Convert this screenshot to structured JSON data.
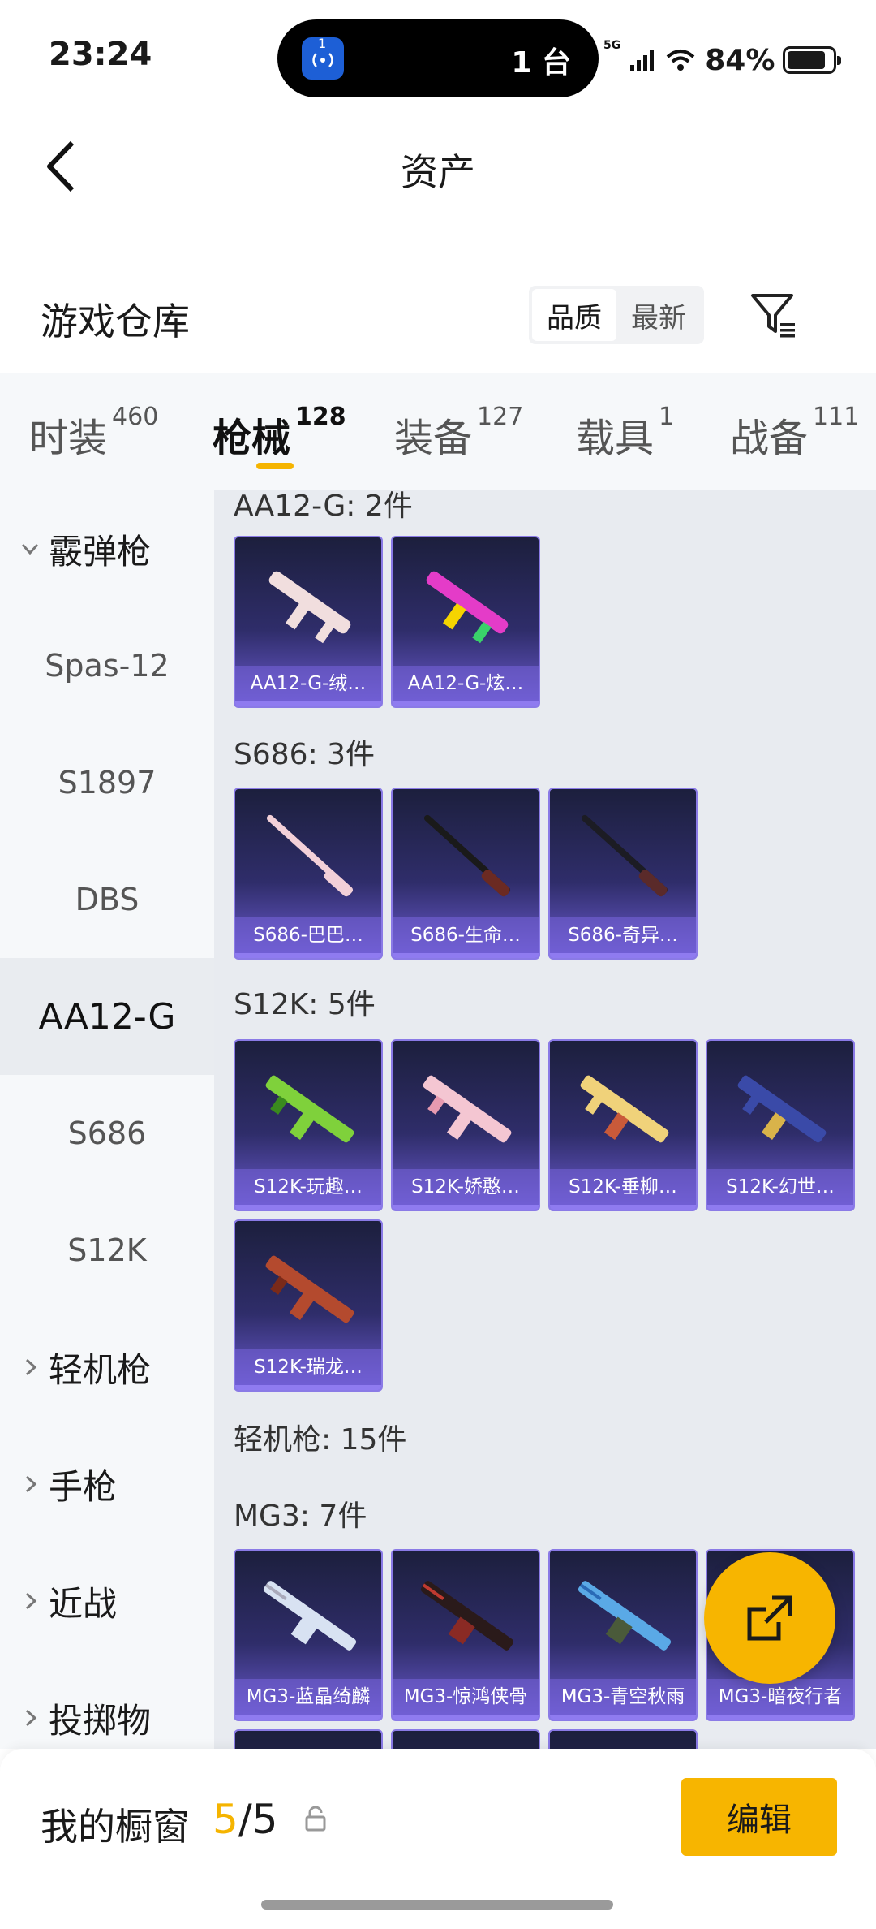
{
  "status": {
    "time": "23:24",
    "island_badge": "1",
    "island_text": "1 台",
    "network": "5G",
    "battery": "84%",
    "battery_level": 0.84
  },
  "header": {
    "title": "资产",
    "back_icon": "chevron-left-icon"
  },
  "warehouse": {
    "title": "游戏仓库",
    "sort_options": [
      "品质",
      "最新"
    ],
    "filter_icon": "filter-icon"
  },
  "tabs": [
    {
      "label": "时装",
      "count": "460"
    },
    {
      "label": "枪械",
      "count": "128",
      "active": true
    },
    {
      "label": "装备",
      "count": "127"
    },
    {
      "label": "载具",
      "count": "1"
    },
    {
      "label": "战备",
      "count": "111"
    }
  ],
  "sidebar": [
    {
      "label": "霰弹枪",
      "type": "group",
      "expanded": true
    },
    {
      "label": "Spas-12",
      "type": "sub"
    },
    {
      "label": "S1897",
      "type": "sub"
    },
    {
      "label": "DBS",
      "type": "sub"
    },
    {
      "label": "AA12-G",
      "type": "sub",
      "active": true
    },
    {
      "label": "S686",
      "type": "sub"
    },
    {
      "label": "S12K",
      "type": "sub"
    },
    {
      "label": "轻机枪",
      "type": "group"
    },
    {
      "label": "手枪",
      "type": "group"
    },
    {
      "label": "近战",
      "type": "group"
    },
    {
      "label": "投掷物",
      "type": "group"
    }
  ],
  "sections": [
    {
      "label": "AA12-G: 2件",
      "items": [
        "AA12-G-绒…",
        "AA12-G-炫…"
      ]
    },
    {
      "label": "S686: 3件",
      "items": [
        "S686-巴巴…",
        "S686-生命…",
        "S686-奇异…"
      ]
    },
    {
      "label": "S12K: 5件",
      "items": [
        "S12K-玩趣…",
        "S12K-娇憨…",
        "S12K-垂柳…",
        "S12K-幻世…",
        "S12K-瑞龙…"
      ]
    },
    {
      "label": "轻机枪: 15件",
      "items": []
    },
    {
      "label": "MG3: 7件",
      "items": [
        "MG3-蓝晶绮麟",
        "MG3-惊鸿侠骨",
        "MG3-青空秋雨",
        "MG3-暗夜行者"
      ]
    }
  ],
  "weapon_colors": {
    "aa12_1": "#f1dede",
    "aa12_2": "#e43cc8",
    "s686_1": "#f3d0d8",
    "s686_2": "#3a1a1a",
    "s686_3": "#2a2a33",
    "s12k_1": "#7fd13b",
    "s12k_2": "#f4c6d2",
    "s12k_3": "#f0d27a",
    "s12k_4": "#3a4aa8",
    "s12k_5": "#b44a2e",
    "mg3_1": "#d8e2f2",
    "mg3_2": "#3a1a1a",
    "mg3_3": "#5aa9e6",
    "mg3_4": "#444"
  },
  "fab": {
    "icon": "share-external-icon"
  },
  "showcase": {
    "label": "我的橱窗",
    "count_used": "5",
    "count_sep": "/",
    "count_total": "5",
    "edit_label": "编辑"
  },
  "accent_color": "#f5b400"
}
